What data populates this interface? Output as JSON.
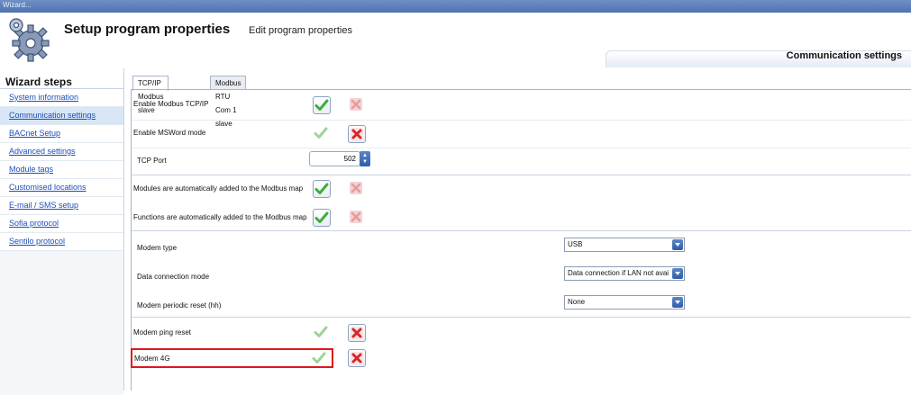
{
  "window": {
    "title": "Wizard..."
  },
  "header": {
    "title": "Setup program properties",
    "subtitle": "Edit program properties",
    "section_tab": "Communication settings"
  },
  "sidebar": {
    "title": "Wizard steps",
    "items": [
      {
        "label": "System information",
        "active": false
      },
      {
        "label": "Communication settings",
        "active": true
      },
      {
        "label": "BACnet Setup",
        "active": false
      },
      {
        "label": "Advanced settings",
        "active": false
      },
      {
        "label": "Module tags",
        "active": false
      },
      {
        "label": "Customised locations",
        "active": false
      },
      {
        "label": "E-mail / SMS setup",
        "active": false
      },
      {
        "label": "Sofia protocol",
        "active": false
      },
      {
        "label": "Sentilo protocol",
        "active": false
      }
    ]
  },
  "tabs": [
    {
      "label": "TCP/IP Modbus slave",
      "active": true
    },
    {
      "label": "Modbus RTU Com 1 slave",
      "active": false
    }
  ],
  "form": {
    "enable_modbus_tcpip": {
      "label": "Enable Modbus TCP/IP",
      "value": true
    },
    "enable_msword_mode": {
      "label": "Enable MSWord mode",
      "value": false
    },
    "tcp_port": {
      "label": "TCP Port",
      "value": "502"
    },
    "modules_auto_added": {
      "label": "Modules are automatically added to the Modbus map",
      "value": true
    },
    "functions_auto_added": {
      "label": "Functions are automatically added to the Modbus map",
      "value": true
    },
    "modem_type": {
      "label": "Modem type",
      "value": "USB"
    },
    "data_connection_mode": {
      "label": "Data connection mode",
      "value": "Data connection if LAN not available"
    },
    "modem_periodic_reset": {
      "label": "Modem periodic reset (hh)",
      "value": "None"
    },
    "modem_ping_reset": {
      "label": "Modem ping reset",
      "value": false
    },
    "modem_4g": {
      "label": "Modem 4G",
      "value": false
    }
  },
  "colors": {
    "check": "#3dae3a",
    "cross": "#d6262b",
    "highlight": "#e0161c",
    "accent": "#2e5ea8"
  }
}
